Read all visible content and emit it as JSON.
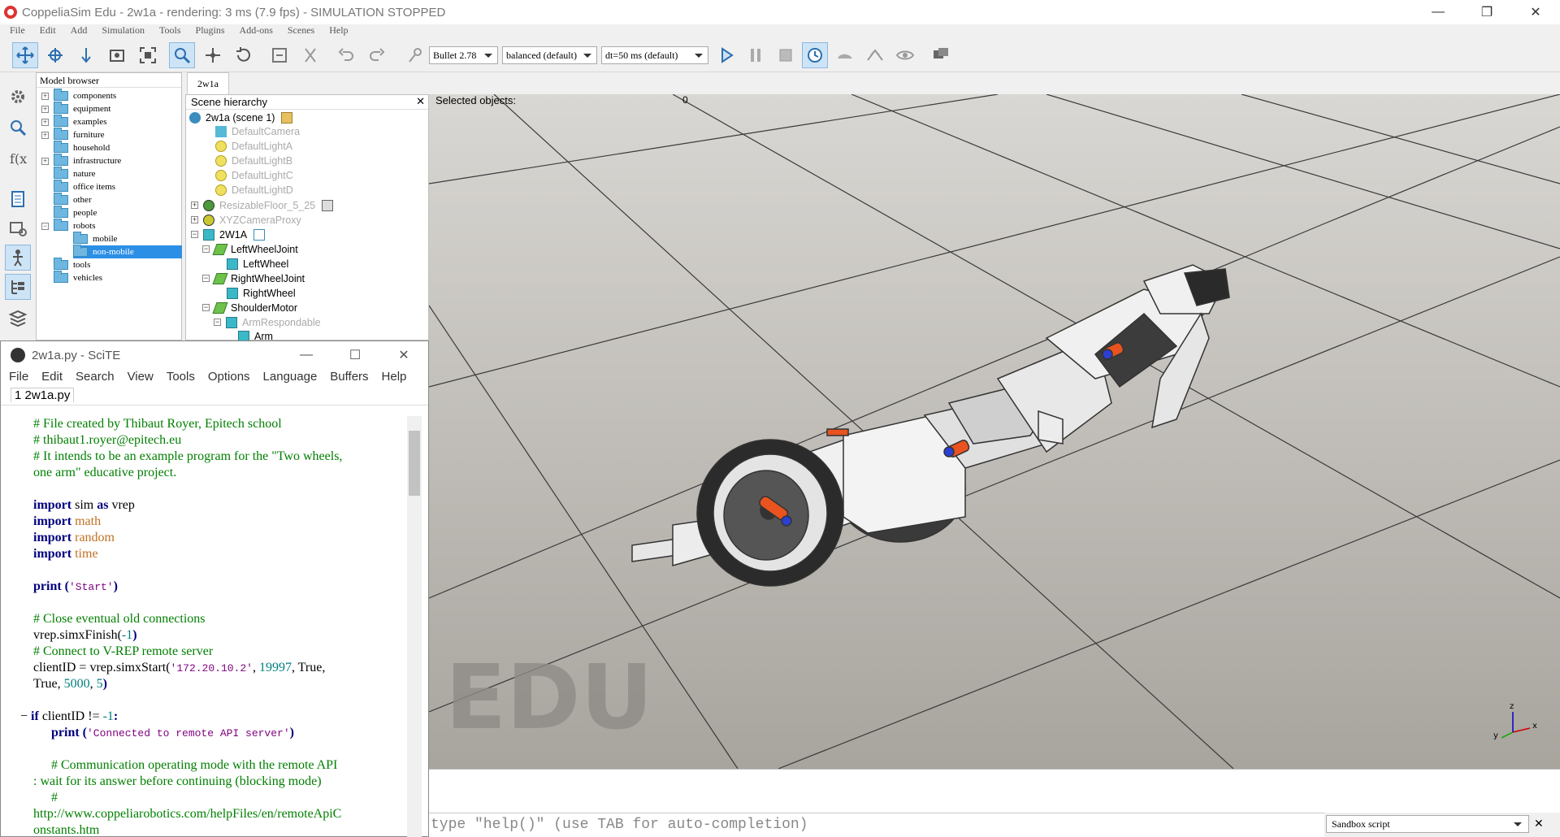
{
  "window": {
    "title": "CoppeliaSim Edu - 2w1a - rendering: 3 ms (7.9 fps) - SIMULATION STOPPED",
    "minimize": "—",
    "restore": "❐",
    "close": "✕"
  },
  "menubar": [
    "File",
    "Edit",
    "Add",
    "Simulation",
    "Tools",
    "Plugins",
    "Add-ons",
    "Scenes",
    "Help"
  ],
  "toolbar": {
    "engine": "Bullet 2.78",
    "accuracy": "balanced (default)",
    "timestep": "dt=50 ms (default)"
  },
  "model_browser": {
    "title": "Model browser",
    "items": [
      {
        "label": "components",
        "expander": "+"
      },
      {
        "label": "equipment",
        "expander": "+"
      },
      {
        "label": "examples",
        "expander": "+"
      },
      {
        "label": "furniture",
        "expander": "+"
      },
      {
        "label": "household",
        "expander": ""
      },
      {
        "label": "infrastructure",
        "expander": "+"
      },
      {
        "label": "nature",
        "expander": ""
      },
      {
        "label": "office items",
        "expander": ""
      },
      {
        "label": "other",
        "expander": ""
      },
      {
        "label": "people",
        "expander": ""
      },
      {
        "label": "robots",
        "expander": "−"
      },
      {
        "label": "mobile",
        "expander": ""
      },
      {
        "label": "non-mobile",
        "expander": ""
      },
      {
        "label": "tools",
        "expander": ""
      },
      {
        "label": "vehicles",
        "expander": ""
      }
    ]
  },
  "scene_tab": "2w1a",
  "hierarchy": {
    "title": "Scene hierarchy",
    "close": "✕",
    "items": [
      {
        "label": "2w1a (scene 1)"
      },
      {
        "label": "DefaultCamera"
      },
      {
        "label": "DefaultLightA"
      },
      {
        "label": "DefaultLightB"
      },
      {
        "label": "DefaultLightC"
      },
      {
        "label": "DefaultLightD"
      },
      {
        "label": "ResizableFloor_5_25"
      },
      {
        "label": "XYZCameraProxy"
      },
      {
        "label": "2W1A"
      },
      {
        "label": "LeftWheelJoint"
      },
      {
        "label": "LeftWheel"
      },
      {
        "label": "RightWheelJoint"
      },
      {
        "label": "RightWheel"
      },
      {
        "label": "ShoulderMotor"
      },
      {
        "label": "ArmRespondable"
      },
      {
        "label": "Arm"
      }
    ]
  },
  "viewport": {
    "selected_label": "Selected objects:",
    "selected_count": "0",
    "watermark": "EDU",
    "axis_x": "x",
    "axis_y": "y",
    "axis_z": "z"
  },
  "scite": {
    "title": "2w1a.py - SciTE",
    "menu": [
      "File",
      "Edit",
      "Search",
      "View",
      "Tools",
      "Options",
      "Language",
      "Buffers",
      "Help"
    ],
    "tab": "1 2w1a.py",
    "code": {
      "l1": "# File created by Thibaut Royer, Epitech school",
      "l2": "# thibaut1.royer@epitech.eu",
      "l3": "# It intends to be an example program for the \"Two wheels,",
      "l4": "one arm\" educative project.",
      "kw_import": "import",
      "mod_sim": " sim ",
      "kw_as": "as",
      "alias": " vrep",
      "mod_math": " math",
      "mod_random": " random",
      "mod_time": " time",
      "kw_print": "print",
      "paren_open": " (",
      "paren_close": ")",
      "str_start": "'Start'",
      "c_close": "# Close eventual old connections",
      "finish": "vrep.simxFinish(",
      "neg_one": "-1",
      "c_connect": "# Connect to V-REP remote server",
      "start_call": "clientID = vrep.simxStart(",
      "str_ip": "'172.20.10.2'",
      "comma": ", ",
      "port": "19997",
      "true_txt": ", True,",
      "true2": "True, ",
      "timeout": "5000",
      "five": "5",
      "fold": "−",
      "kw_if": "if",
      "cond": " clientID != ",
      "colon": ":",
      "str_conn": "'Connected to remote API server'",
      "c_mode1": "# Communication operating mode with the remote API",
      "c_mode2": ": wait for its answer before continuing (blocking mode)",
      "c_hash": "#",
      "url1": "http://www.coppeliarobotics.com/helpFiles/en/remoteApiC",
      "url2": "onstants.htm"
    }
  },
  "console": {
    "prompt": "type \"help()\" (use TAB for auto-completion)",
    "script_type": "Sandbox script",
    "close": "✕"
  }
}
